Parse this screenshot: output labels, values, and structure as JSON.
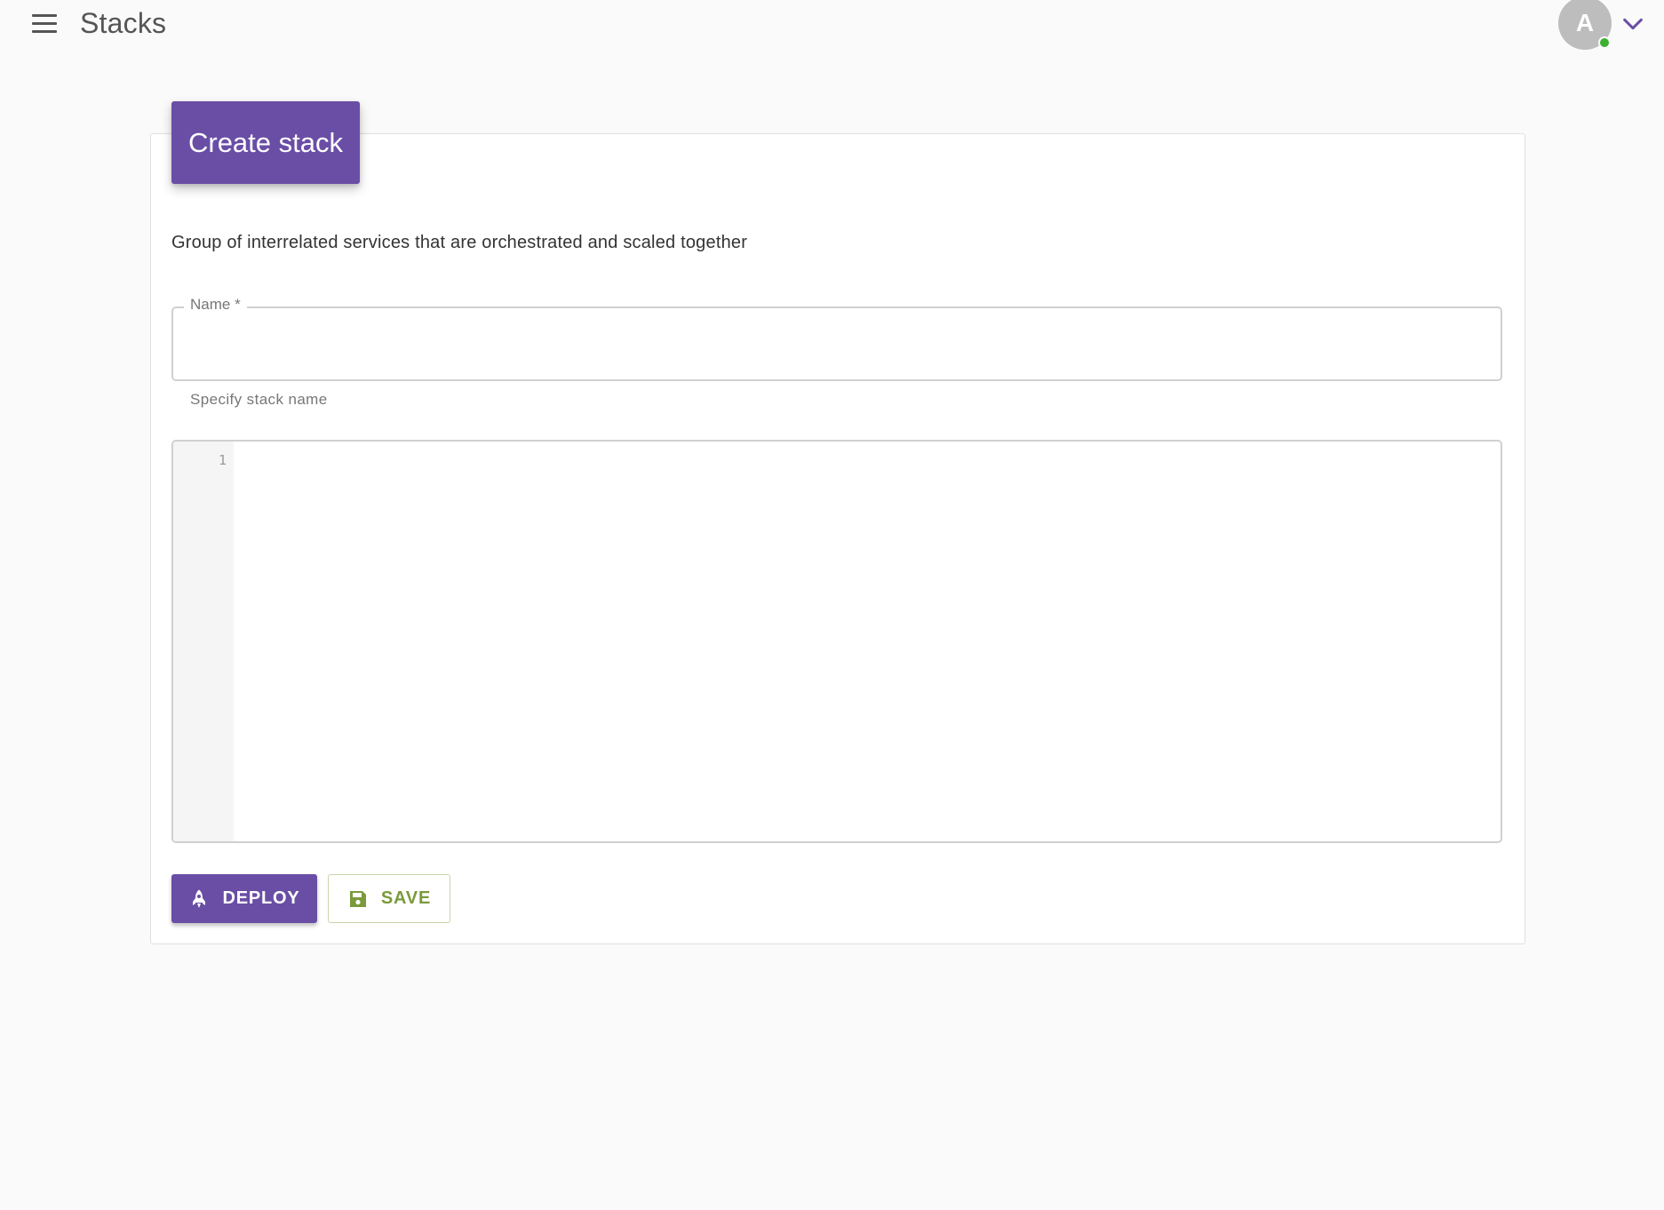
{
  "header": {
    "title": "Stacks",
    "avatar_initial": "A",
    "online_status_color": "#3bb12f"
  },
  "card": {
    "title": "Create stack",
    "description": "Group of interrelated services that are orchestrated and scaled together",
    "name_field": {
      "label": "Name *",
      "value": "",
      "helper": "Specify stack name"
    },
    "editor": {
      "line_numbers": [
        "1"
      ],
      "content": ""
    },
    "actions": {
      "deploy_label": "DEPLOY",
      "save_label": "SAVE"
    }
  },
  "colors": {
    "primary": "#6a4ea5",
    "save_accent": "#7a9a3c",
    "background": "#fafafa"
  },
  "icons": {
    "menu": "menu-icon",
    "account_dropdown": "chevron-down-icon",
    "deploy": "rocket-icon",
    "save": "floppy-disk-icon"
  }
}
